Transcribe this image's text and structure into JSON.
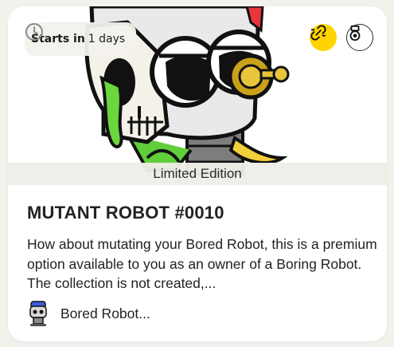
{
  "card": {
    "starts": {
      "prefix": "Starts in",
      "value": "1 days"
    },
    "edition": "Limited Edition",
    "title": "MUTANT ROBOT #0010",
    "description": "How about mutating your Bored Robot, this is a premium option available to you as an owner of a Boring Robot. The collection is not created,...",
    "creator": "Bored Robot..."
  },
  "icons": {
    "clock": "clock-icon",
    "link": "broken-link-icon",
    "token": "token-medal-icon",
    "avatar": "robot-avatar"
  },
  "colors": {
    "accent_yellow": "#ffd400",
    "background": "#f3f1ec",
    "card": "#ffffff",
    "text": "#222222"
  }
}
